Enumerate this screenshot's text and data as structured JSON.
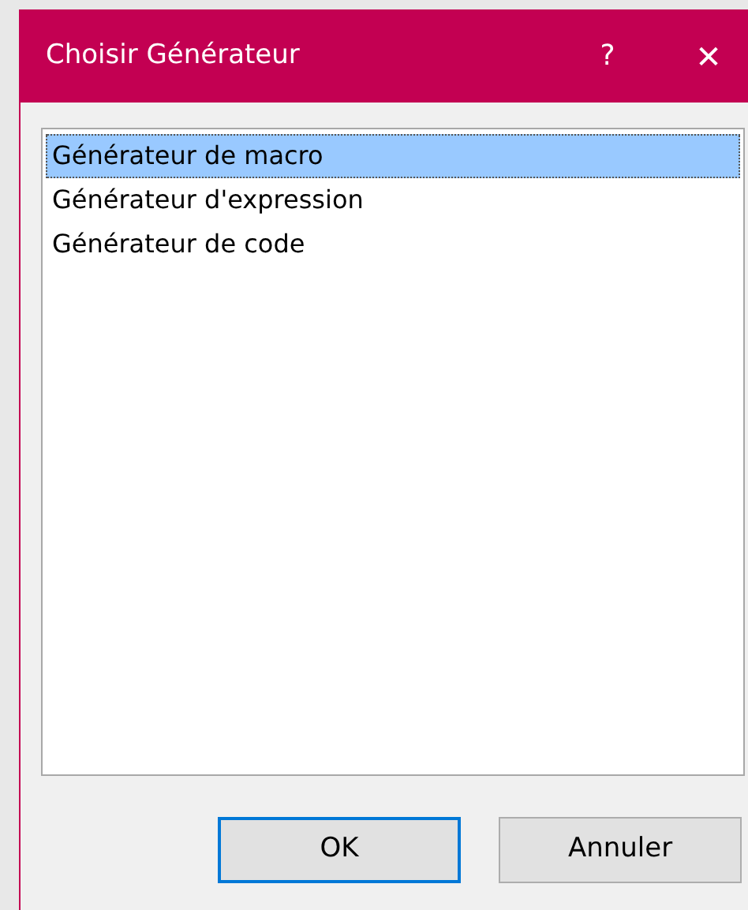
{
  "window": {
    "title": "Choisir Générateur",
    "help": "?",
    "close": "✕"
  },
  "list": {
    "items": [
      {
        "label": "Générateur de macro",
        "selected": true
      },
      {
        "label": "Générateur d'expression",
        "selected": false
      },
      {
        "label": "Générateur de code",
        "selected": false
      }
    ]
  },
  "buttons": [
    {
      "label": "OK",
      "default": true
    },
    {
      "label": "Annuler",
      "default": false
    }
  ]
}
